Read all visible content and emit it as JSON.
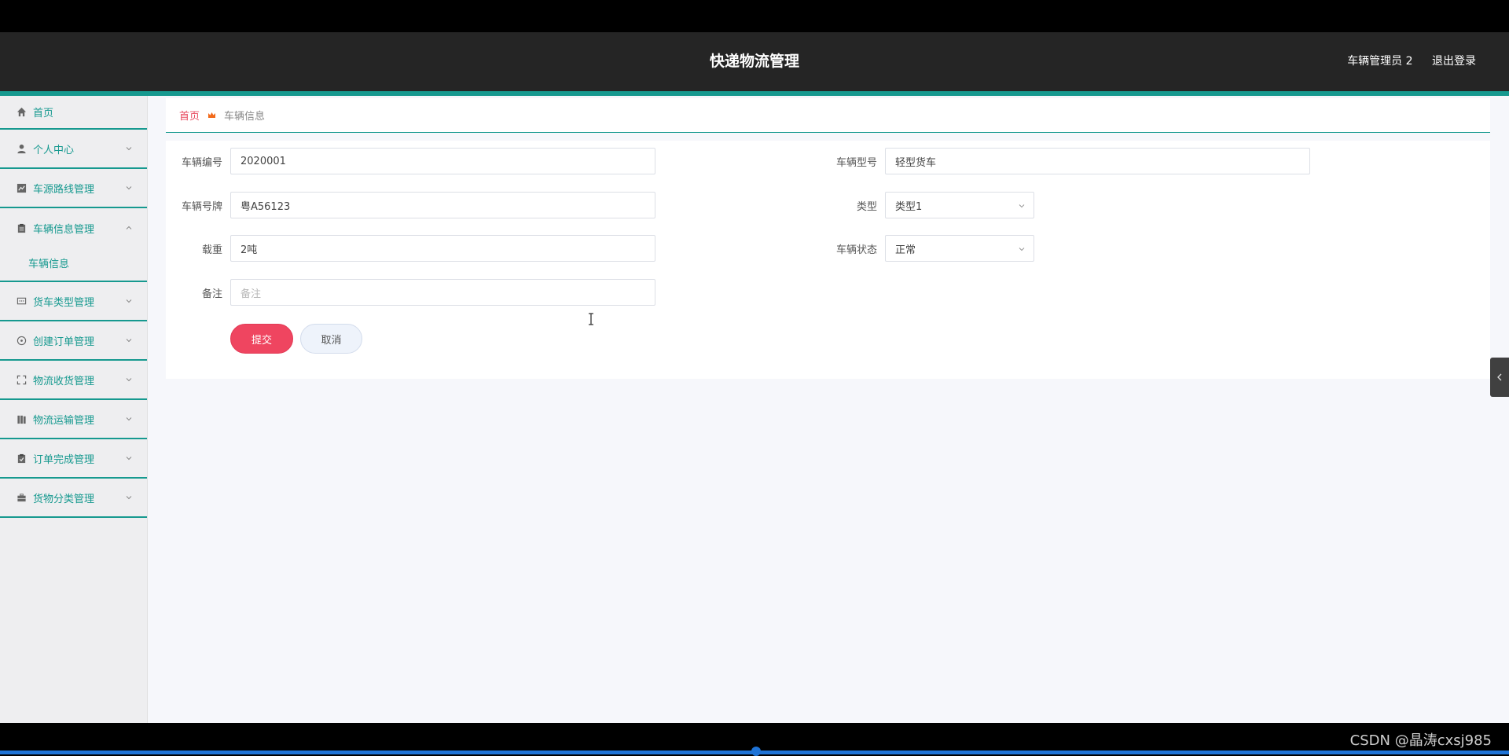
{
  "app": {
    "title": "快递物流管理",
    "user": "车辆管理员 2",
    "logout": "退出登录"
  },
  "colors": {
    "accent": "#16998f",
    "danger": "#ef4560",
    "header": "#252525"
  },
  "sidebar": {
    "items": [
      {
        "label": "首页",
        "icon": "home-icon"
      },
      {
        "label": "个人中心",
        "icon": "user-icon"
      },
      {
        "label": "车源路线管理",
        "icon": "chart-icon"
      },
      {
        "label": "车辆信息管理",
        "icon": "clipboard-icon",
        "expanded": true
      },
      {
        "label": "车辆信息",
        "sub": true
      },
      {
        "label": "货车类型管理",
        "icon": "chat-icon"
      },
      {
        "label": "创建订单管理",
        "icon": "compass-icon"
      },
      {
        "label": "物流收货管理",
        "icon": "fullscreen-icon"
      },
      {
        "label": "物流运输管理",
        "icon": "books-icon"
      },
      {
        "label": "订单完成管理",
        "icon": "clipboard-check-icon"
      },
      {
        "label": "货物分类管理",
        "icon": "briefcase-icon"
      }
    ]
  },
  "breadcrumb": {
    "home": "首页",
    "current": "车辆信息"
  },
  "form": {
    "vehicle_no": {
      "label": "车辆编号",
      "value": "2020001"
    },
    "vehicle_model": {
      "label": "车辆型号",
      "value": "轻型货车"
    },
    "plate": {
      "label": "车辆号牌",
      "value": "粤A56123"
    },
    "type": {
      "label": "类型",
      "value": "类型1"
    },
    "load": {
      "label": "载重",
      "value": "2吨"
    },
    "status": {
      "label": "车辆状态",
      "value": "正常"
    },
    "remark": {
      "label": "备注",
      "placeholder": "备注"
    },
    "submit": "提交",
    "cancel": "取消"
  },
  "watermark": "CSDN @晶涛cxsj985"
}
